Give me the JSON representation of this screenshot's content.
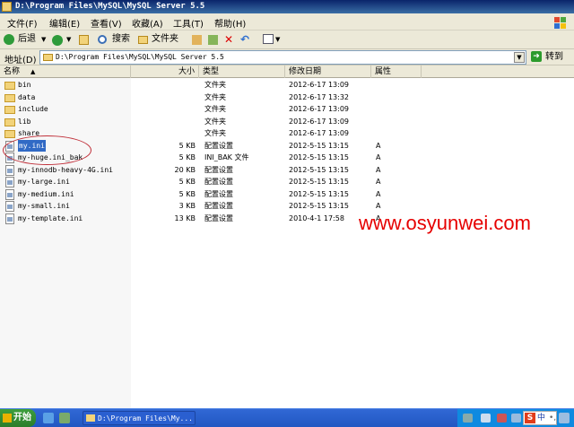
{
  "window": {
    "title": "D:\\Program Files\\MySQL\\MySQL Server 5.5"
  },
  "menu": [
    "文件(F)",
    "编辑(E)",
    "查看(V)",
    "收藏(A)",
    "工具(T)",
    "帮助(H)"
  ],
  "toolbar": {
    "back": "后退",
    "search": "搜索",
    "folders": "文件夹"
  },
  "address": {
    "label": "地址(D)",
    "path": "D:\\Program Files\\MySQL\\MySQL Server 5.5",
    "go": "转到"
  },
  "columns": {
    "name": "名称",
    "size": "大小",
    "type": "类型",
    "modified": "修改日期",
    "attr": "属性"
  },
  "files": [
    {
      "name": "bin",
      "size": "",
      "type": "文件夹",
      "date": "2012-6-17 13:09",
      "attr": "",
      "kind": "folder"
    },
    {
      "name": "data",
      "size": "",
      "type": "文件夹",
      "date": "2012-6-17 13:32",
      "attr": "",
      "kind": "folder"
    },
    {
      "name": "include",
      "size": "",
      "type": "文件夹",
      "date": "2012-6-17 13:09",
      "attr": "",
      "kind": "folder"
    },
    {
      "name": "lib",
      "size": "",
      "type": "文件夹",
      "date": "2012-6-17 13:09",
      "attr": "",
      "kind": "folder"
    },
    {
      "name": "share",
      "size": "",
      "type": "文件夹",
      "date": "2012-6-17 13:09",
      "attr": "",
      "kind": "folder"
    },
    {
      "name": "my.ini",
      "size": "5 KB",
      "type": "配置设置",
      "date": "2012-5-15 13:15",
      "attr": "A",
      "kind": "file",
      "selected": true
    },
    {
      "name": "my-huge.ini_bak",
      "size": "5 KB",
      "type": "INI_BAK 文件",
      "date": "2012-5-15 13:15",
      "attr": "A",
      "kind": "file"
    },
    {
      "name": "my-innodb-heavy-4G.ini",
      "size": "20 KB",
      "type": "配置设置",
      "date": "2012-5-15 13:15",
      "attr": "A",
      "kind": "file"
    },
    {
      "name": "my-large.ini",
      "size": "5 KB",
      "type": "配置设置",
      "date": "2012-5-15 13:15",
      "attr": "A",
      "kind": "file"
    },
    {
      "name": "my-medium.ini",
      "size": "5 KB",
      "type": "配置设置",
      "date": "2012-5-15 13:15",
      "attr": "A",
      "kind": "file"
    },
    {
      "name": "my-small.ini",
      "size": "3 KB",
      "type": "配置设置",
      "date": "2012-5-15 13:15",
      "attr": "A",
      "kind": "file"
    },
    {
      "name": "my-template.ini",
      "size": "13 KB",
      "type": "配置设置",
      "date": "2010-4-1 17:58",
      "attr": "A",
      "kind": "file"
    }
  ],
  "watermark": "www.osyunwei.com",
  "taskbar": {
    "start": "开始",
    "task": "D:\\Program Files\\My...",
    "ime_zh": "中",
    "ime_dot": "•,"
  },
  "colors": {
    "title": "#0a246a",
    "selection": "#316ac5",
    "watermark": "#e60000",
    "taskbar": "#2157c2"
  }
}
